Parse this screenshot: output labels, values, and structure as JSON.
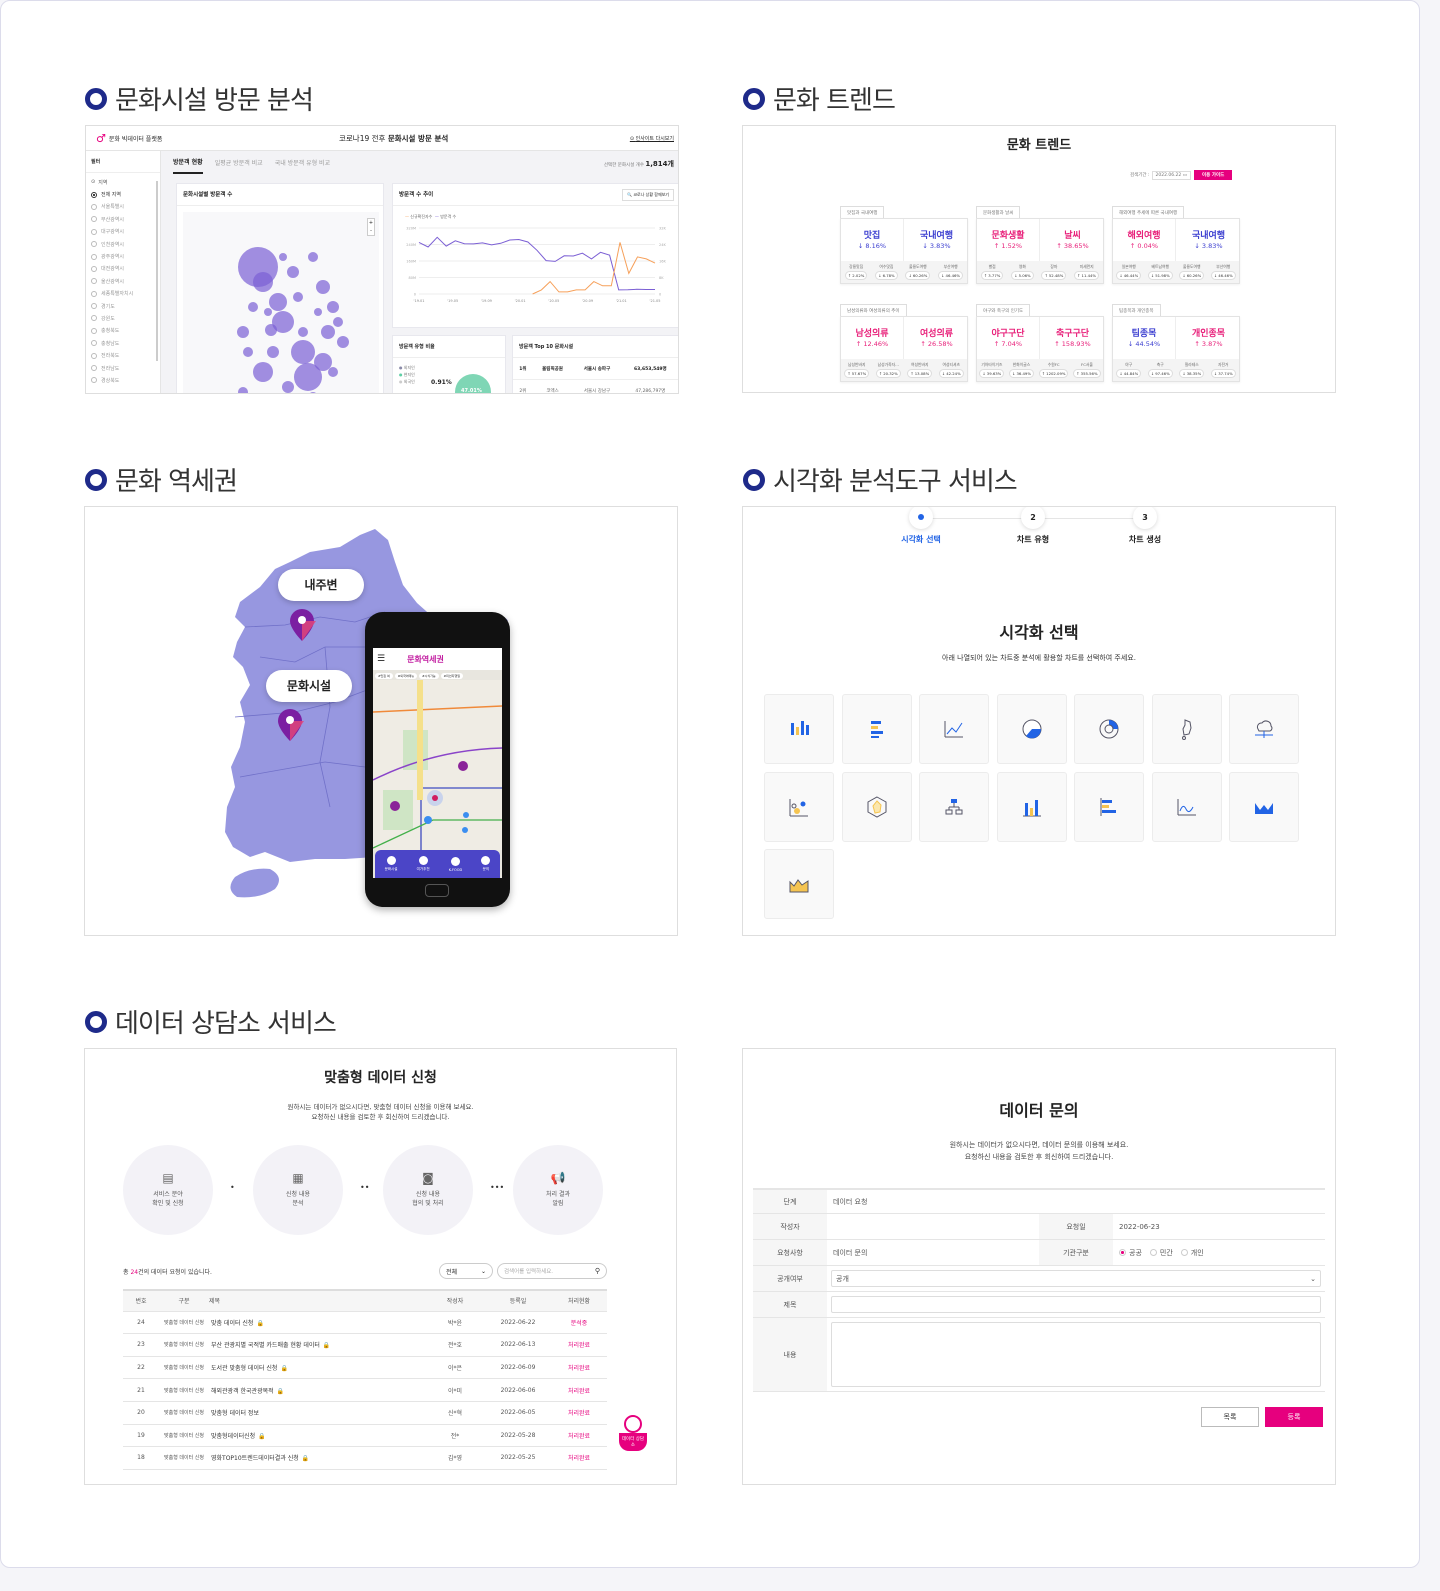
{
  "sections": {
    "visit_analysis": "문화시설 방문 분석",
    "trend": "문화 트렌드",
    "station_area": "문화 역세권",
    "viz_tool": "시각화 분석도구 서비스",
    "consult": "데이터 상담소 서비스"
  },
  "visit": {
    "logo": "문화 빅데이터 플랫폼",
    "title_prefix": "코로나19 전후",
    "title": "문화시설 방문 분석",
    "insight_link": "인사이트 다시보기",
    "filter_label": "필터",
    "tabs": [
      "방문객 현황",
      "일평균 방문객 비교",
      "국내 방문객 유형 비교"
    ],
    "selected_count_label": "선택한 문화시설 개수",
    "selected_count": "1,814개",
    "region_label": "지역",
    "regions": [
      "전체 지역",
      "서울특별시",
      "부산광역시",
      "대구광역시",
      "인천광역시",
      "광주광역시",
      "대전광역시",
      "울산광역시",
      "세종특별자치시",
      "경기도",
      "강원도",
      "충청북도",
      "충청남도",
      "전라북도",
      "전라남도",
      "경상북도"
    ],
    "map_card_title": "문화시설별 방문객 수",
    "zoom_in": "+",
    "zoom_out": "-",
    "trend_card_title": "방문객 수 추이",
    "covid_button": "코로나 상황 함께보기",
    "legend": [
      "신규확진자수",
      "방문객 수"
    ],
    "chart": {
      "y_left_ticks": [
        "0",
        "80M",
        "160M",
        "240M",
        "320M"
      ],
      "y_right_ticks": [
        "0",
        "8K",
        "16K",
        "24K",
        "32K"
      ],
      "x_ticks": [
        "'19.01",
        "'19.05",
        "'19.09",
        "'20.01",
        "'20.05",
        "'20.09",
        "'21.01",
        "'21.05"
      ],
      "y_left_label": "방문객 수",
      "y_right_label": "신규확진자 수",
      "visitors": [
        250,
        228,
        275,
        232,
        258,
        244,
        243,
        248,
        238,
        246,
        262,
        264,
        252,
        212,
        162,
        158,
        185,
        184,
        198,
        170,
        202,
        188,
        20,
        21,
        23,
        22,
        22
      ],
      "covid": [
        null,
        null,
        null,
        null,
        null,
        null,
        null,
        null,
        null,
        null,
        null,
        null,
        null,
        0,
        2,
        6,
        1,
        1,
        2,
        2,
        6,
        4,
        4,
        25,
        10,
        18,
        17,
        15
      ]
    },
    "type_card_title": "방문객 유형 비율",
    "type_legend": [
      "외지인",
      "현지인",
      "외국인"
    ],
    "type_value": "0.91%",
    "type_value_label": "외국인",
    "type_big": "47.01%",
    "top10_title": "방문객 Top 10 문화시설",
    "top10": [
      {
        "rank": "1위",
        "name": "올림픽공원",
        "addr": "서울시 송파구",
        "count": "63,653,549명"
      },
      {
        "rank": "2위",
        "name": "코엑스",
        "addr": "서울시 강남구",
        "count": "47,286,797명"
      }
    ]
  },
  "trend": {
    "title": "문화 트렌드",
    "period_label": "검색기간 :",
    "period_value": "2022.06.22",
    "guide_button": "이용 가이드",
    "cards": [
      {
        "tab": "맛집과 국내여행",
        "a": {
          "k": "맛집",
          "v": "↓ 8.16%",
          "c": "blue"
        },
        "b": {
          "k": "국내여행",
          "v": "↓ 3.83%",
          "c": "blue"
        },
        "foot": [
          [
            "강릉맛집",
            "↑ 2.02%"
          ],
          [
            "여수맛집",
            "↓ 6.78%"
          ],
          [
            "울릉도여행",
            "↓ 60.26%"
          ],
          [
            "부산여행",
            "↓ 46.46%"
          ]
        ]
      },
      {
        "tab": "문화생활과 날씨",
        "a": {
          "k": "문화생활",
          "v": "↑ 1.52%",
          "c": "pink"
        },
        "b": {
          "k": "날씨",
          "v": "↑ 38.65%",
          "c": "pink"
        },
        "foot": [
          [
            "별점",
            "↑ 3.77%"
          ],
          [
            "영화",
            "↓ 5.06%"
          ],
          [
            "장마",
            "↑ 52.48%"
          ],
          [
            "미세먼지",
            "↑ 11.44%"
          ]
        ]
      },
      {
        "tab": "해외여행 추세에 따른 국내여행",
        "a": {
          "k": "해외여행",
          "v": "↑ 0.04%",
          "c": "pink"
        },
        "b": {
          "k": "국내여행",
          "v": "↓ 3.83%",
          "c": "blue"
        },
        "foot": [
          [
            "일본여행",
            "↓ 46.44%"
          ],
          [
            "베트남여행",
            "↓ 51.98%"
          ],
          [
            "울릉도여행",
            "↓ 60.26%"
          ],
          [
            "부산여행",
            "↓ 46.46%"
          ]
        ]
      },
      {
        "tab": "남성의류와 여성의류의 추이",
        "a": {
          "k": "남성의류",
          "v": "↑ 12.46%",
          "c": "pink"
        },
        "b": {
          "k": "여성의류",
          "v": "↑ 26.58%",
          "c": "pink"
        },
        "foot": [
          [
            "남성반바지",
            "↑ 57.67%"
          ],
          [
            "남성가죽자…",
            "↑ 20.32%"
          ],
          [
            "여성반바지",
            "↑ 13.08%"
          ],
          [
            "여성티셔츠",
            "↓ 42.24%"
          ]
        ]
      },
      {
        "tab": "야구와 축구의 인기도",
        "a": {
          "k": "야구구단",
          "v": "↑ 7.04%",
          "c": "pink"
        },
        "b": {
          "k": "축구구단",
          "v": "↑ 158.93%",
          "c": "pink"
        },
        "foot": [
          [
            "기아타이거즈",
            "↓ 39.63%"
          ],
          [
            "한화이글스",
            "↓ 36.49%"
          ],
          [
            "수원FC",
            "↑ 1202.09%"
          ],
          [
            "FC서울",
            "↑ 355.56%"
          ]
        ]
      },
      {
        "tab": "팀종목과 개인종목",
        "a": {
          "k": "팀종목",
          "v": "↓ 44.54%",
          "c": "blue"
        },
        "b": {
          "k": "개인종목",
          "v": "↑ 3.87%",
          "c": "pink"
        },
        "foot": [
          [
            "야구",
            "↓ 44.84%"
          ],
          [
            "축구",
            "↓ 97.46%"
          ],
          [
            "필라테스",
            "↓ 38.35%"
          ],
          [
            "자전거",
            "↓ 37.74%"
          ]
        ]
      }
    ]
  },
  "station": {
    "bubble1": "내주변",
    "bubble2": "문화시설",
    "app_title": "문화역세권",
    "chips": [
      "#맛집 여",
      "#외국어메뉴",
      "#시식가능",
      "#미션지행일"
    ],
    "nav": [
      "문화시설",
      "여가추천",
      "K-FOOD",
      "문의"
    ]
  },
  "viz": {
    "steps": [
      {
        "num": "",
        "label": "시각화 선택"
      },
      {
        "num": "2",
        "label": "차트 유형"
      },
      {
        "num": "3",
        "label": "차트 생성"
      }
    ],
    "title": "시각화 선택",
    "desc": "아래 나열되어 있는 차트중 분석에 활용할 차트를 선택하여 주세요.",
    "charts": [
      "stacked-bar",
      "horizontal-bar",
      "line",
      "pie",
      "donut",
      "korea-map",
      "cloud-network",
      "bubble",
      "radar",
      "tree",
      "column",
      "bar-horizontal-stacked",
      "spline",
      "stream",
      "area"
    ]
  },
  "consult": {
    "title": "맞춤형 데이터 신청",
    "desc1": "원하시는 데이터가 없으시다면, 맞춤형 데이터 신청을 이용해 보세요.",
    "desc2": "요청하신 내용을 검토한 후 회신하여 드리겠습니다.",
    "steps": [
      {
        "l1": "서비스 분야",
        "l2": "확인 및 신청"
      },
      {
        "l1": "신청 내용",
        "l2": "분석"
      },
      {
        "l1": "신청 내용",
        "l2": "협의 및 처리"
      },
      {
        "l1": "처리 결과",
        "l2": "알림"
      }
    ],
    "count_prefix": "총 ",
    "count": "24",
    "count_suffix": "건의 데이터 요청이 있습니다.",
    "filter": "전체",
    "search_placeholder": "검색어를 입력하세요.",
    "columns": [
      "번호",
      "구분",
      "제목",
      "작성자",
      "등록일",
      "처리현황"
    ],
    "rows": [
      {
        "no": "24",
        "cat": "맞춤형 데이터 신청",
        "title": "맞춤 데이터 신청",
        "lock": true,
        "writer": "박*윤",
        "date": "2022-06-22",
        "status": "분석중"
      },
      {
        "no": "23",
        "cat": "맞춤형 데이터 신청",
        "title": "부산 관광지별 국적별 카드매출 현황 데이터",
        "lock": true,
        "writer": "전*호",
        "date": "2022-06-13",
        "status": "처리완료"
      },
      {
        "no": "22",
        "cat": "맞춤형 데이터 신청",
        "title": "도서관 맞춤형 데이터 신청",
        "lock": true,
        "writer": "이*은",
        "date": "2022-06-09",
        "status": "처리완료"
      },
      {
        "no": "21",
        "cat": "맞춤형 데이터 신청",
        "title": "해외관광객 한국관광목적",
        "lock": true,
        "writer": "이*미",
        "date": "2022-06-06",
        "status": "처리완료"
      },
      {
        "no": "20",
        "cat": "맞춤형 데이터 신청",
        "title": "맞춤형 데이터 정보",
        "lock": false,
        "writer": "신*혁",
        "date": "2022-06-05",
        "status": "처리완료"
      },
      {
        "no": "19",
        "cat": "맞춤형 데이터 신청",
        "title": "맞춤형데이터신청",
        "lock": true,
        "writer": "전*",
        "date": "2022-05-28",
        "status": "처리완료"
      },
      {
        "no": "18",
        "cat": "맞춤형 데이터 신청",
        "title": "영화TOP10트렌드데이터결과 신청",
        "lock": true,
        "writer": "김*영",
        "date": "2022-05-25",
        "status": "처리완료"
      }
    ],
    "float_badge": "데이터 상담소"
  },
  "inquiry": {
    "title": "데이터 문의",
    "desc1": "원하시는 데이터가 없으시다면, 데이터 문의를 이용해 보세요.",
    "desc2": "요청하신 내용을 검토한 후 회신하여 드리겠습니다.",
    "fields": {
      "stage_label": "단계",
      "stage_value": "데이터 요청",
      "writer_label": "작성자",
      "writer_value": "",
      "date_label": "요청일",
      "date_value": "2022-06-23",
      "request_label": "요청사항",
      "request_value": "데이터 문의",
      "org_label": "기관구분",
      "org_options": [
        "공공",
        "민간",
        "개인"
      ],
      "org_selected": "공공",
      "public_label": "공개여부",
      "public_value": "공개",
      "subject_label": "제목",
      "subject_value": "",
      "content_label": "내용",
      "content_value": ""
    },
    "list_button": "목록",
    "submit_button": "등록"
  },
  "colors": {
    "accent": "#e6007e",
    "navy": "#1e2a8a",
    "purple": "#7b5fd4",
    "blue": "#3c3fd0",
    "pink": "#e8207a",
    "orange": "#f6a05a"
  }
}
